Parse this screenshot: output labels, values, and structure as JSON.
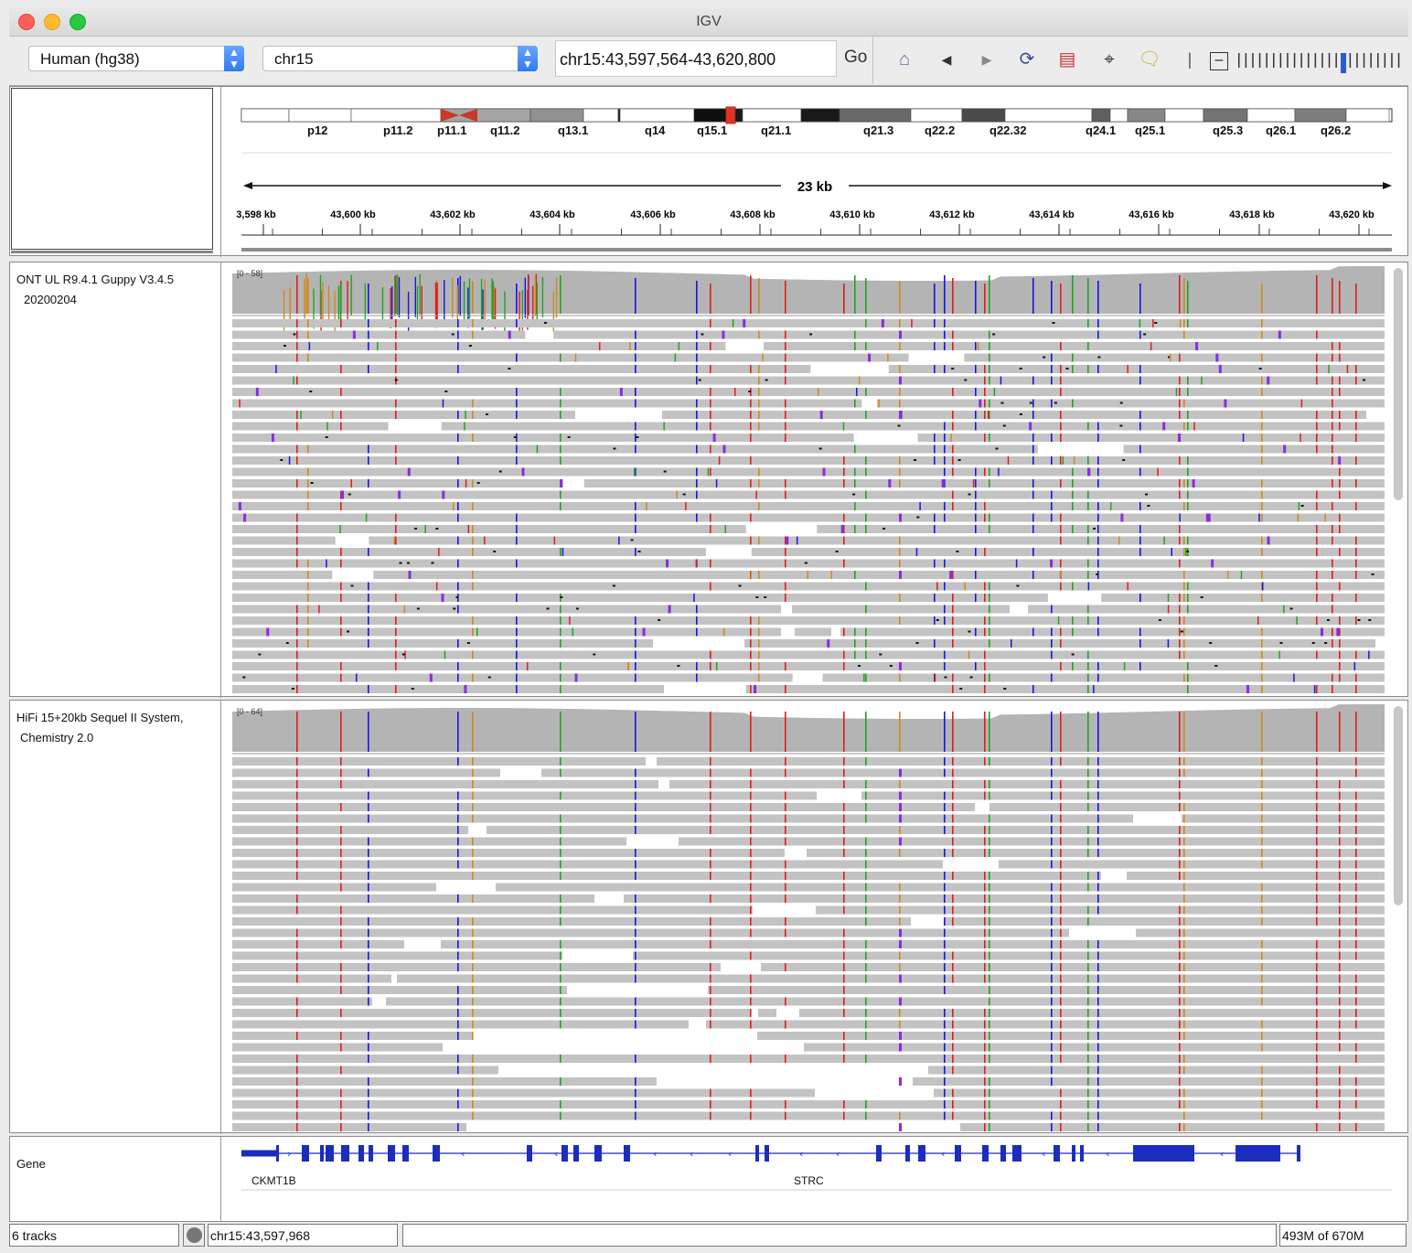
{
  "window": {
    "title": "IGV"
  },
  "toolbar": {
    "genome": "Human (hg38)",
    "chromosome": "chr15",
    "locus": "chr15:43,597,564-43,620,800",
    "go_label": "Go"
  },
  "ideogram": {
    "bands": [
      "p12",
      "p11.2",
      "p11.1",
      "q11.2",
      "q13.1",
      "q14",
      "q15.1",
      "q21.1",
      "q21.3",
      "q22.2",
      "q22.32",
      "q24.1",
      "q25.1",
      "q25.3",
      "q26.1",
      "q26.2"
    ]
  },
  "ruler": {
    "span_label": "23 kb",
    "ticks": [
      "3,598 kb",
      "43,600 kb",
      "43,602 kb",
      "43,604 kb",
      "43,606 kb",
      "43,608 kb",
      "43,610 kb",
      "43,612 kb",
      "43,614 kb",
      "43,616 kb",
      "43,618 kb",
      "43,620 kb"
    ]
  },
  "tracks": {
    "ont": {
      "name_line1": "ONT UL R9.4.1 Guppy V3.4.5",
      "name_line2": "20200204",
      "range": "[0 - 58]"
    },
    "hifi": {
      "name_line1": "HiFi 15+20kb Sequel II System,",
      "name_line2": "Chemistry 2.0",
      "range": "[0 - 64]"
    },
    "gene": {
      "name": "Gene",
      "labels": [
        "CKMT1B",
        "STRC"
      ]
    }
  },
  "status": {
    "tracks": "6 tracks",
    "position": "chr15:43,597,968",
    "memory": "493M of 670M"
  },
  "colors": {
    "A": "#1fa51f",
    "C": "#1515e6",
    "G": "#d1891b",
    "T": "#e31b1b",
    "read": "#c3c3c3",
    "coverage": "#b4b4b4",
    "gene": "#1c2dbd",
    "insertion": "#8a2be2"
  }
}
